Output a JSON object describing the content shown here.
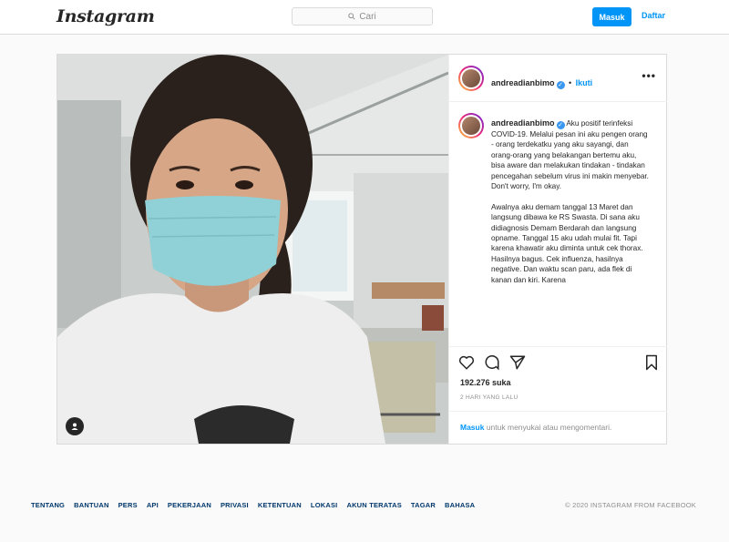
{
  "nav": {
    "logo": "Instagram",
    "search_placeholder": "Cari",
    "login_label": "Masuk",
    "signup_label": "Daftar"
  },
  "post": {
    "username": "andreadianbimo",
    "follow_label": "Ikuti",
    "bullet": "•",
    "more_icon": "more-icon",
    "caption": "Aku positif terinfeksi COVID-19. Melalui pesan ini aku pengen orang - orang terdekatku yang aku sayangi, dan orang-orang yang belakangan bertemu aku, bisa aware dan melakukan tindakan - tindakan pencegahan sebelum virus ini makin menyebar.\nDon't worry, I'm okay.\n\nAwalnya aku demam tanggal 13 Maret dan langsung dibawa ke RS Swasta. Di sana aku didiagnosis Demam Berdarah dan langsung opname. Tanggal 15 aku udah mulai fit. Tapi karena khawatir aku diminta untuk cek thorax. Hasilnya bagus. Cek influenza, hasilnya negative. Dan waktu scan paru, ada flek di kanan dan kiri. Karena",
    "likes": "192.276 suka",
    "time": "2 HARI YANG LALU",
    "login_link": "Masuk",
    "login_text": " untuk menyukai atau mengomentari."
  },
  "footer": {
    "links": [
      "TENTANG",
      "BANTUAN",
      "PERS",
      "API",
      "PEKERJAAN",
      "PRIVASI",
      "KETENTUAN",
      "LOKASI",
      "AKUN TERATAS",
      "TAGAR",
      "BAHASA"
    ],
    "copyright": "© 2020 INSTAGRAM FROM FACEBOOK"
  },
  "colors": {
    "accent": "#0095f6",
    "mask": "#8fd1d6"
  }
}
